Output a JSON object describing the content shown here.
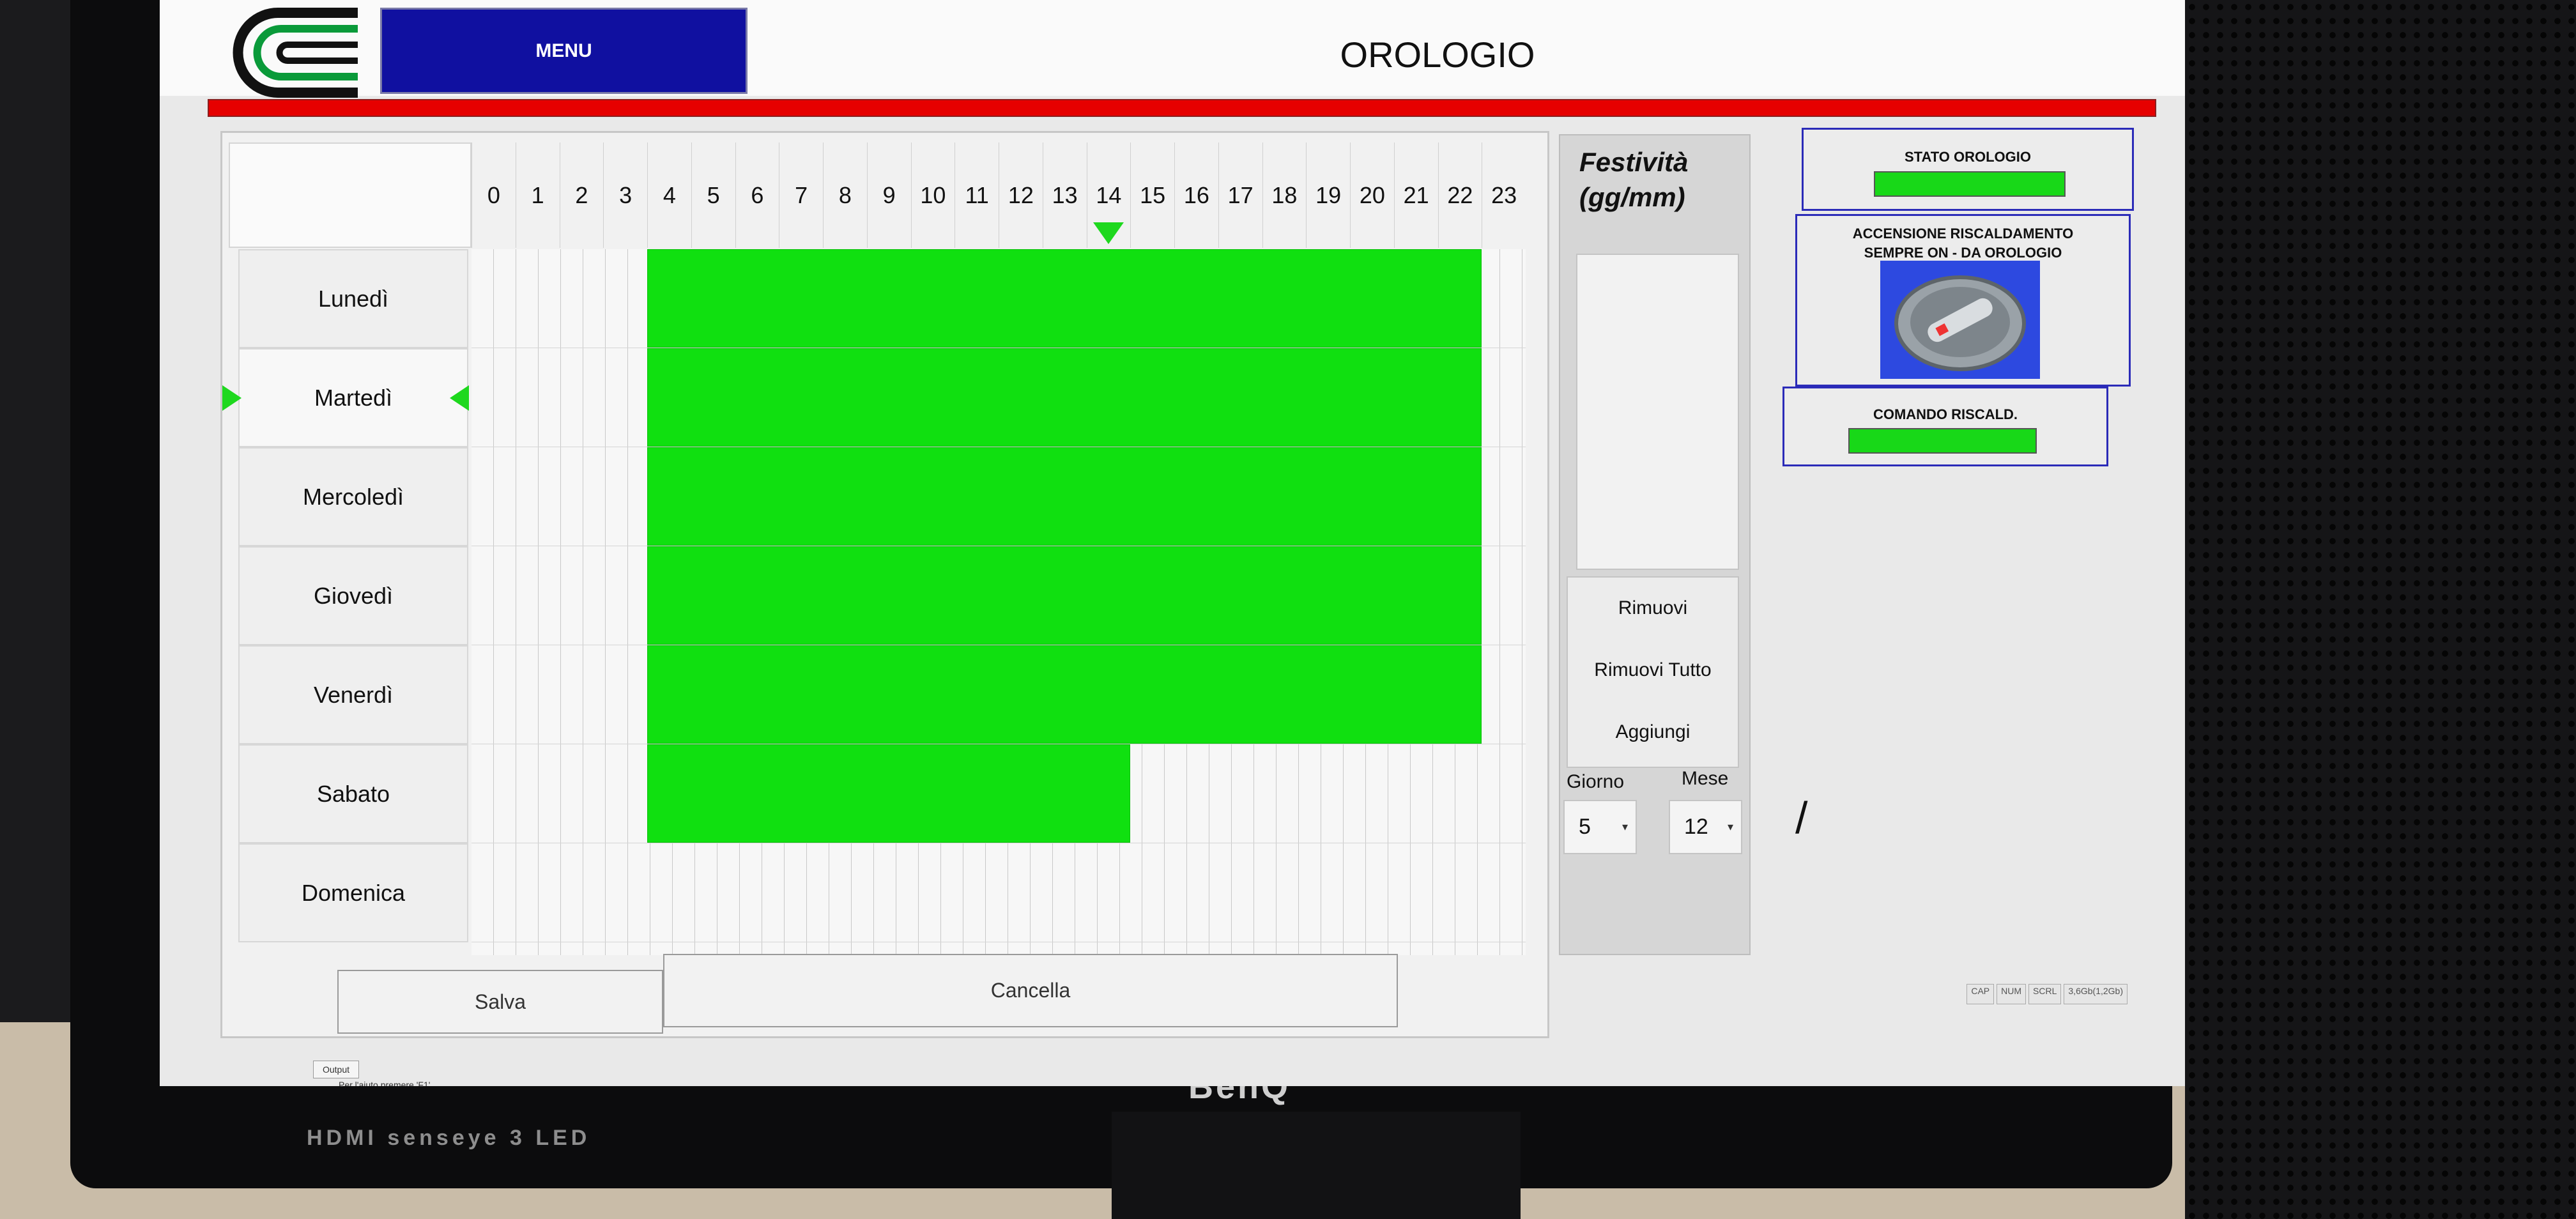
{
  "header": {
    "menu_label": "MENU",
    "page_title": "OROLOGIO"
  },
  "schedule": {
    "hours": [
      "0",
      "1",
      "2",
      "3",
      "4",
      "5",
      "6",
      "7",
      "8",
      "9",
      "10",
      "11",
      "12",
      "13",
      "14",
      "15",
      "16",
      "17",
      "18",
      "19",
      "20",
      "21",
      "22",
      "23"
    ],
    "current_hour": 14,
    "days": [
      {
        "label": "Lunedì",
        "on_from": 4,
        "on_to": 22
      },
      {
        "label": "Martedì",
        "on_from": 4,
        "on_to": 22
      },
      {
        "label": "Mercoledì",
        "on_from": 4,
        "on_to": 22
      },
      {
        "label": "Giovedì",
        "on_from": 4,
        "on_to": 22
      },
      {
        "label": "Venerdì",
        "on_from": 4,
        "on_to": 22
      },
      {
        "label": "Sabato",
        "on_from": 4,
        "on_to": 14
      },
      {
        "label": "Domenica",
        "on_from": null,
        "on_to": null
      }
    ],
    "selected_day": 1,
    "save_label": "Salva",
    "cancel_label": "Cancella"
  },
  "holidays": {
    "title": "Festività (gg/mm)",
    "remove_label": "Rimuovi",
    "remove_all_label": "Rimuovi Tutto",
    "add_label": "Aggiungi",
    "day_label": "Giorno",
    "month_label": "Mese",
    "day_value": "5",
    "month_value": "12",
    "separator": "/"
  },
  "status": {
    "clock_state_label": "STATO OROLOGIO",
    "heating_mode_label_line1": "ACCENSIONE RISCALDAMENTO",
    "heating_mode_label_line2": "SEMPRE ON    -    DA OROLOGIO",
    "heating_command_label": "COMANDO RISCALD."
  },
  "taskbar": {
    "indicators": [
      "CAP",
      "NUM",
      "SCRL"
    ],
    "memory": "3,6Gb(1,2Gb)",
    "output_tab": "Output",
    "status_text": "Per l'aiuto premere 'F1'"
  },
  "monitor": {
    "brand": "BenQ",
    "ports": "HDMI  senseye 3  LED"
  },
  "colors": {
    "on_slot": "#10e010",
    "accent_red": "#e60000",
    "menu_blue": "#1010a0",
    "status_border": "#2b2bb8"
  }
}
